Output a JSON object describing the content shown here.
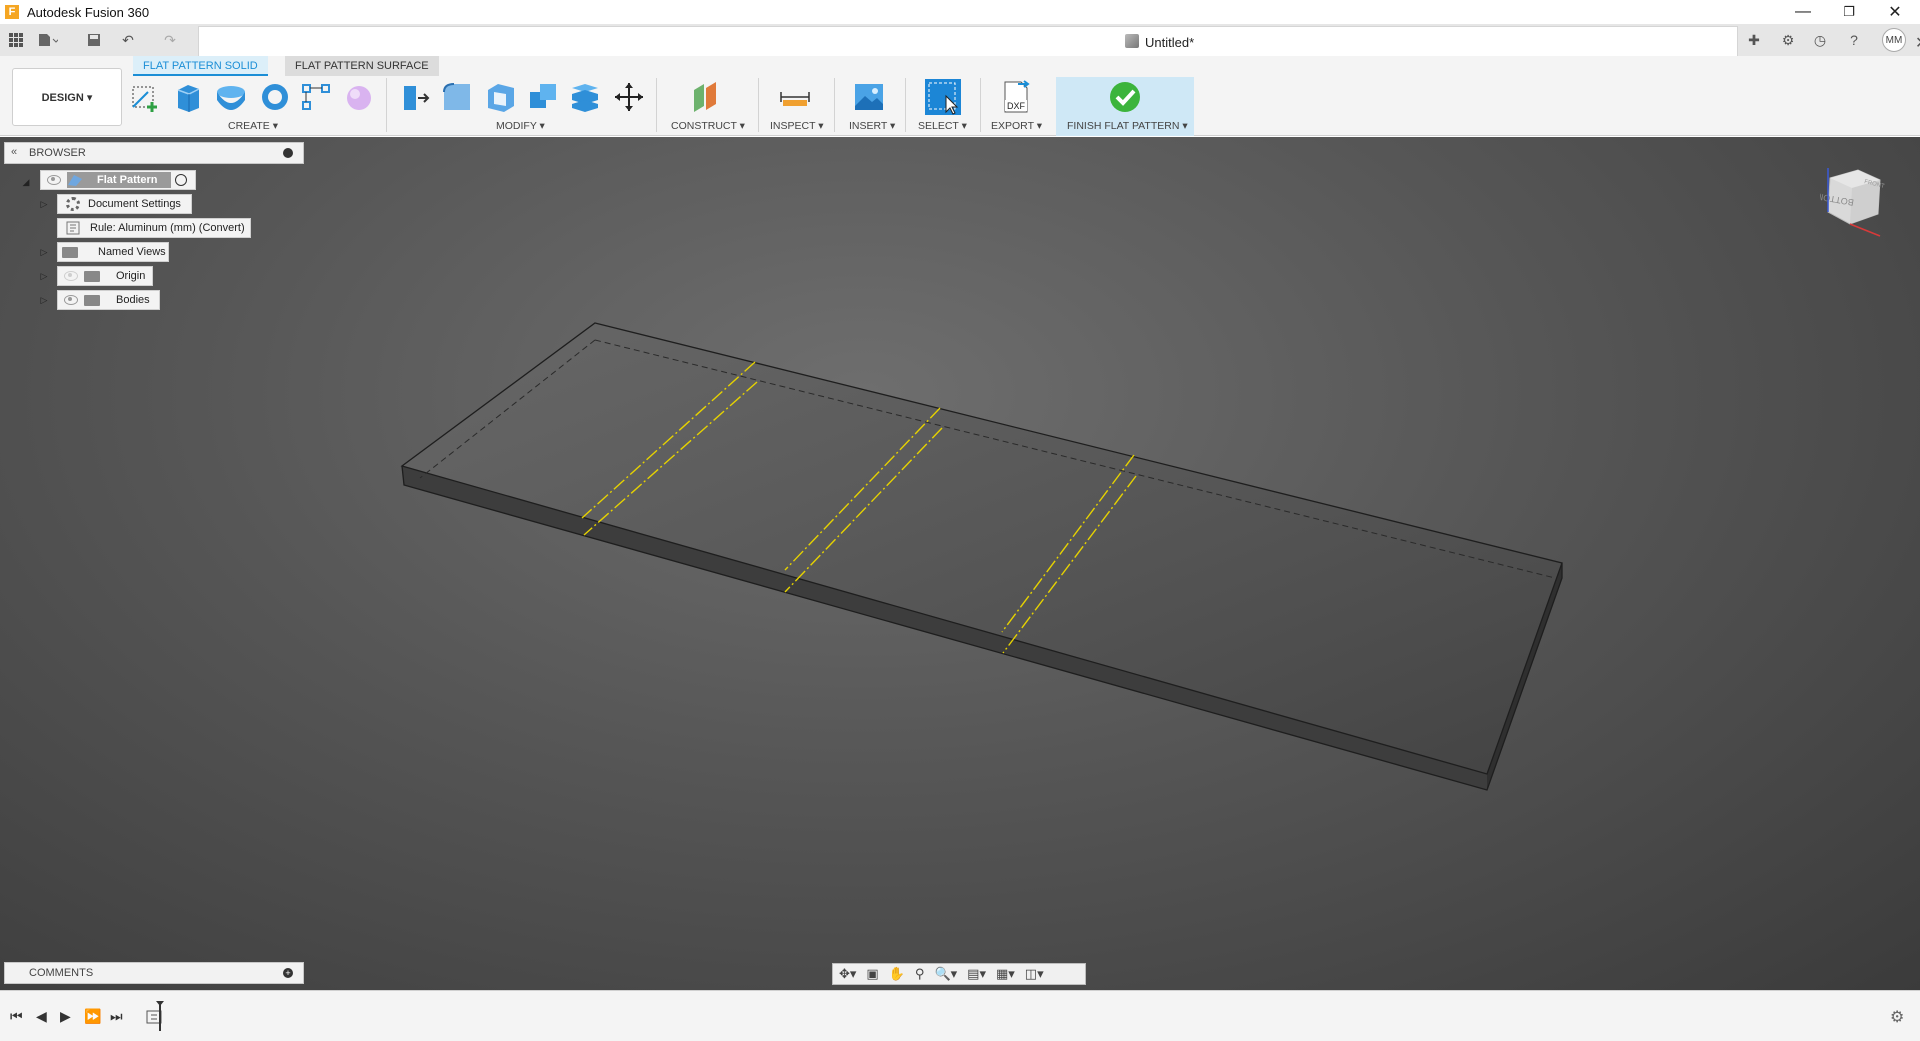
{
  "titlebar": {
    "app_title": "Autodesk Fusion 360"
  },
  "document": {
    "tab_title": "Untitled*"
  },
  "user": {
    "initials": "MM"
  },
  "ribbon": {
    "tabs": [
      {
        "label": "FLAT PATTERN SOLID",
        "active": true
      },
      {
        "label": "FLAT PATTERN SURFACE",
        "active": false
      }
    ],
    "workspace": "DESIGN ▾",
    "groups": {
      "create": "CREATE ▾",
      "modify": "MODIFY ▾",
      "construct": "CONSTRUCT ▾",
      "inspect": "INSPECT ▾",
      "insert": "INSERT ▾",
      "select": "SELECT ▾",
      "export": "EXPORT ▾",
      "finish": "FINISH FLAT PATTERN ▾"
    }
  },
  "browser": {
    "title": "BROWSER",
    "root": "Flat Pattern",
    "items": [
      {
        "label": "Document Settings"
      },
      {
        "label": "Rule: Aluminum (mm) (Convert)"
      },
      {
        "label": "Named Views"
      },
      {
        "label": "Origin"
      },
      {
        "label": "Bodies"
      }
    ]
  },
  "comments": {
    "title": "COMMENTS"
  },
  "viewcube": {
    "top": "FRONT",
    "face": "BOTTOM"
  },
  "colors": {
    "accent": "#1b8ed6",
    "bend_line": "#e6d200",
    "finish_check": "#3cb43c"
  },
  "icons": {
    "export_label": "DXF"
  }
}
